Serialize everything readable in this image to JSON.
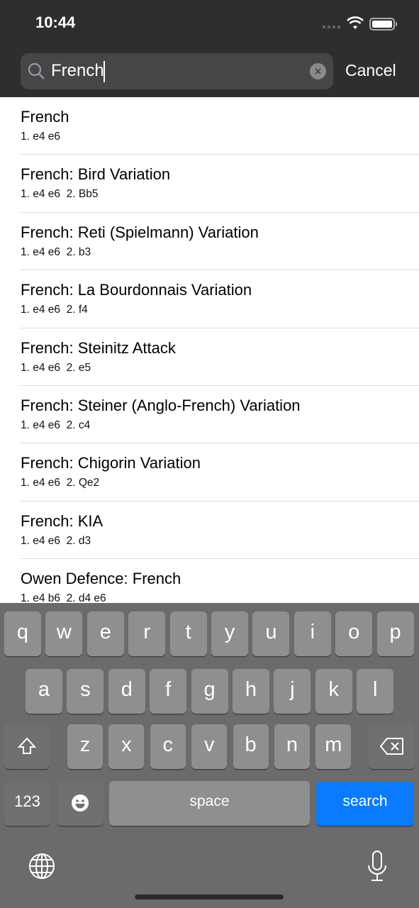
{
  "status": {
    "time": "10:44"
  },
  "search": {
    "value": "French",
    "cancel": "Cancel"
  },
  "results": [
    {
      "title": "French",
      "moves": "1. e4 e6"
    },
    {
      "title": "French: Bird Variation",
      "moves": "1. e4 e6  2. Bb5"
    },
    {
      "title": "French: Reti (Spielmann) Variation",
      "moves": "1. e4 e6  2. b3"
    },
    {
      "title": "French: La Bourdonnais Variation",
      "moves": "1. e4 e6  2. f4"
    },
    {
      "title": "French: Steinitz Attack",
      "moves": "1. e4 e6  2. e5"
    },
    {
      "title": "French: Steiner (Anglo-French) Variation",
      "moves": "1. e4 e6  2. c4"
    },
    {
      "title": "French: Chigorin Variation",
      "moves": "1. e4 e6  2. Qe2"
    },
    {
      "title": "French: KIA",
      "moves": "1. e4 e6  2. d3"
    },
    {
      "title": "Owen Defence: French",
      "moves": "1. e4 b6  2. d4 e6"
    }
  ],
  "keyboard": {
    "row1": [
      "q",
      "w",
      "e",
      "r",
      "t",
      "y",
      "u",
      "i",
      "o",
      "p"
    ],
    "row2": [
      "a",
      "s",
      "d",
      "f",
      "g",
      "h",
      "j",
      "k",
      "l"
    ],
    "row3": [
      "z",
      "x",
      "c",
      "v",
      "b",
      "n",
      "m"
    ],
    "numbers": "123",
    "space": "space",
    "search": "search",
    "accent": "#0a7bff"
  }
}
